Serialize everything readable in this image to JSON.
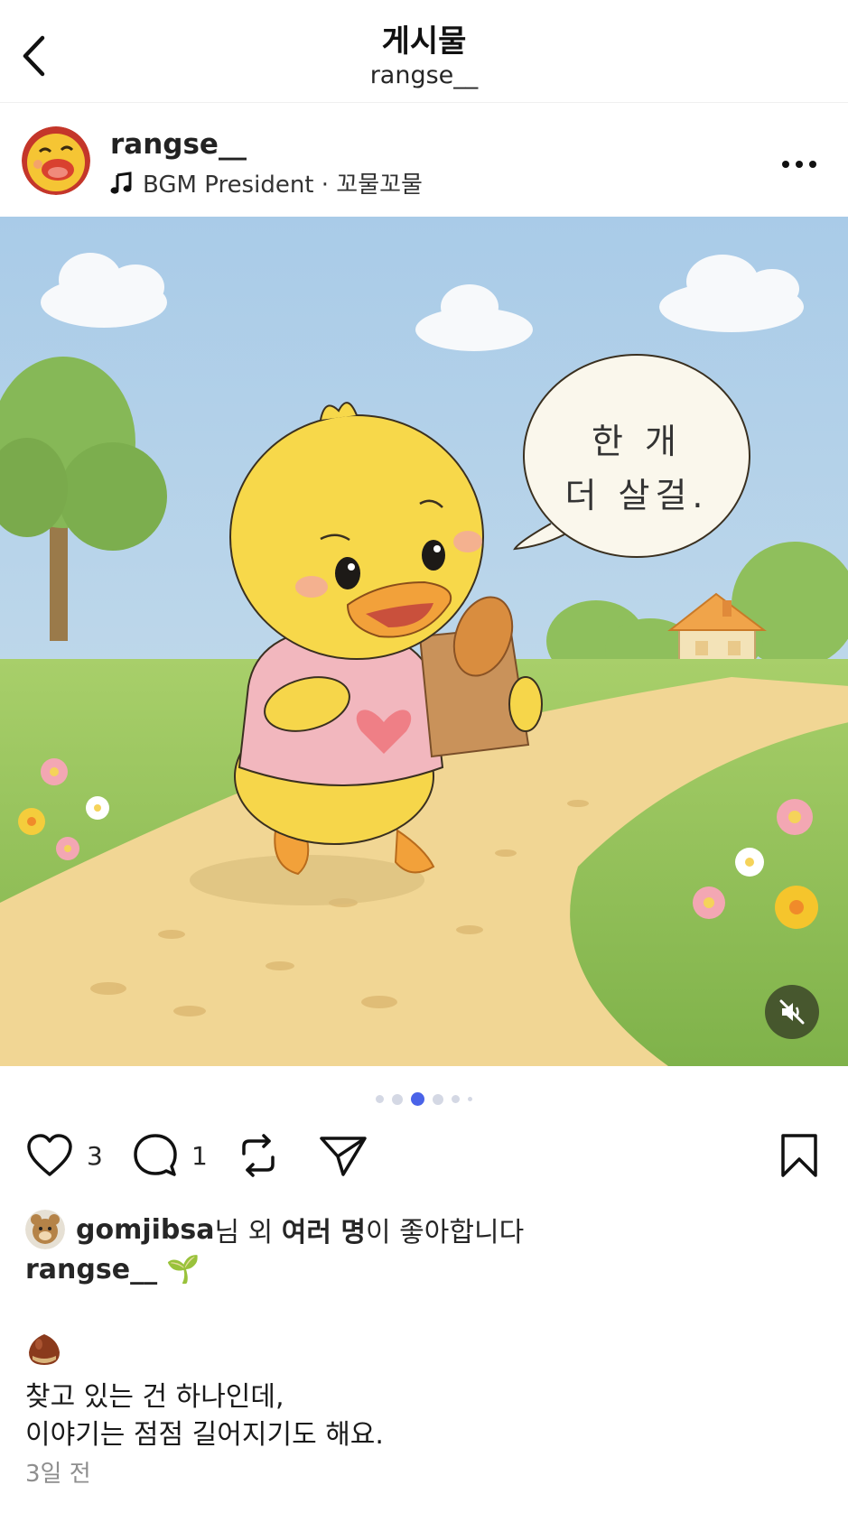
{
  "header": {
    "title": "게시물",
    "subtitle": "rangse__"
  },
  "post": {
    "username": "rangse__",
    "music": "BGM President · 꼬물꼬물",
    "speech_line1": "한 개",
    "speech_line2": "더 살걸.",
    "carousel_total": 6,
    "carousel_active": 3
  },
  "actions": {
    "likes": "3",
    "comments": "1"
  },
  "likes_line": {
    "user": "gomjibsa",
    "part1": "님 외 ",
    "bold": "여러 명",
    "part2": "이 좋아합니다"
  },
  "caption": {
    "username": "rangse__",
    "sprout": "🌱",
    "line1": "찾고 있는 건 하나인데,",
    "line2": "이야기는 점점 길어지기도 해요."
  },
  "time_ago": "3일 전",
  "icons": [
    "back-icon",
    "more-icon",
    "music-note-icon",
    "mute-icon",
    "heart-icon",
    "comment-icon",
    "repost-icon",
    "send-icon",
    "bookmark-icon",
    "chestnut-icon"
  ],
  "colors": {
    "accent_dot": "#4a63e8"
  }
}
